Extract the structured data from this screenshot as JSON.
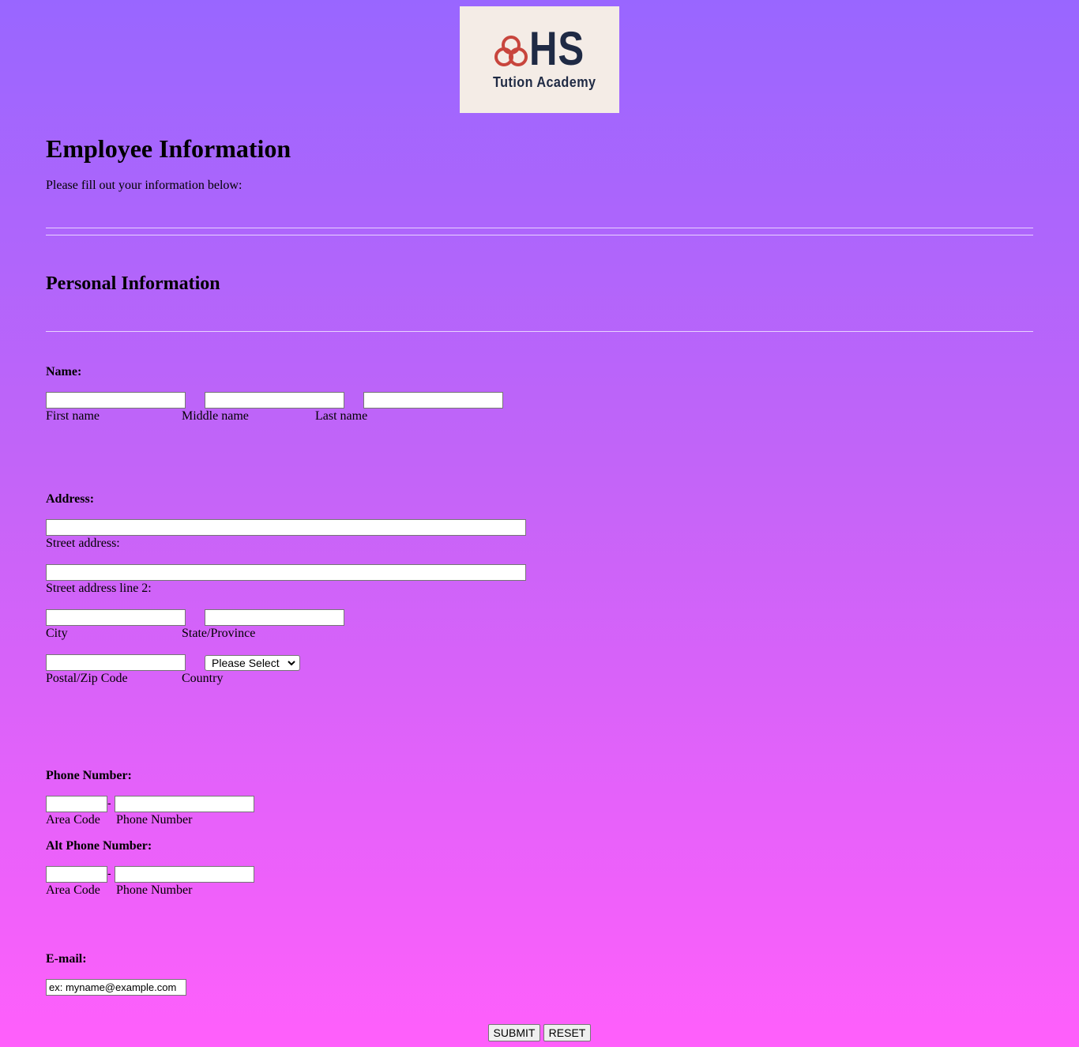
{
  "logo": {
    "brand": "HS",
    "tagline": "Tution Academy"
  },
  "header": {
    "title": "Employee Information",
    "subtitle": "Please fill out your information below:"
  },
  "section": {
    "title": "Personal Information"
  },
  "name": {
    "label": "Name:",
    "first_label": "First name",
    "middle_label": "Middle name",
    "last_label": "Last name"
  },
  "address": {
    "label": "Address:",
    "street_label": "Street address:",
    "street2_label": "Street address line 2:",
    "city_label": "City",
    "state_label": "State/Province",
    "zip_label": "Postal/Zip Code",
    "country_label": "Country",
    "country_value": "Please Select"
  },
  "phone": {
    "label": "Phone Number:",
    "area_label": "Area Code",
    "number_label": "Phone Number",
    "separator": "-"
  },
  "alt_phone": {
    "label": "Alt Phone Number:",
    "area_label": "Area Code",
    "number_label": "Phone Number",
    "separator": "-"
  },
  "email": {
    "label": "E-mail:",
    "placeholder": "ex: myname@example.com"
  },
  "buttons": {
    "submit": "SUBMIT",
    "reset": "RESET"
  },
  "colors": {
    "gradient_top": "#9966ff",
    "gradient_bottom": "#ff5ffb",
    "logo_bg": "#f4ece6",
    "logo_text": "#1f2a44",
    "logo_mark": "#c8453d"
  }
}
